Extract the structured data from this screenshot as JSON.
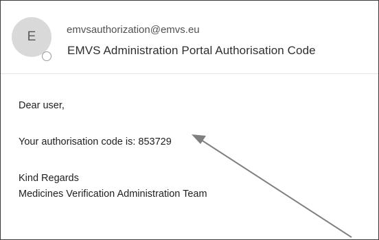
{
  "email": {
    "avatar_initial": "E",
    "sender": "emvsauthorization@emvs.eu",
    "subject": "EMVS Administration Portal Authorisation Code"
  },
  "body": {
    "greeting": "Dear user,",
    "code_line": "Your authorisation code is: 853729",
    "closing": "Kind Regards",
    "signature": "Medicines Verification Administration Team"
  },
  "colors": {
    "avatar_bg": "#d9d9d9",
    "arrow": "#7f7f7f"
  }
}
